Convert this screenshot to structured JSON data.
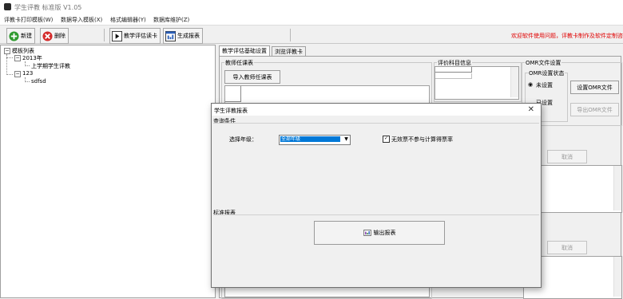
{
  "app": {
    "title": "学生评教 标准版 V1.05"
  },
  "menu": [
    "评教卡打印模板(W)",
    "数据导入模板(X)",
    "格式编辑器(Y)",
    "数据库维护(Z)"
  ],
  "toolbar": {
    "new_label": "新建",
    "delete_label": "删除",
    "read_card_label": "教学评估读卡",
    "report_label": "生成报表",
    "welcome_text": "欢迎软件使用问题，评教卡制作及软件定制咨"
  },
  "tree": {
    "root": "模板列表",
    "year_2013": "2013年",
    "item_1": "上学期学生评教",
    "node_123": "123",
    "item_2": "sdfsd"
  },
  "tabs": [
    "教学评估基础设置",
    "浏览评教卡"
  ],
  "panel": {
    "teacher_group": "教师任课表",
    "import_teacher_label": "导入教师任课表",
    "subject_group": "评价科目信息",
    "omr_group": "OMR文件设置",
    "omr_status_group": "OMR设置状态",
    "radio_unset": "未设置",
    "radio_set": "已设置",
    "set_omr_label": "设置OMR文件",
    "export_omr_label": "导出OMR文件",
    "cancel_label_1": "取消",
    "cancel_label_2": "取消"
  },
  "dialog": {
    "title": "学生评教报表",
    "query_section": "查询条件",
    "grade_label": "选择年级：",
    "grade_value": "全部年级",
    "checkbox_label": "无效票不参与计算得票率",
    "checkbox_checked": true,
    "report_section": "标准报表",
    "export_label": "输出报表"
  }
}
